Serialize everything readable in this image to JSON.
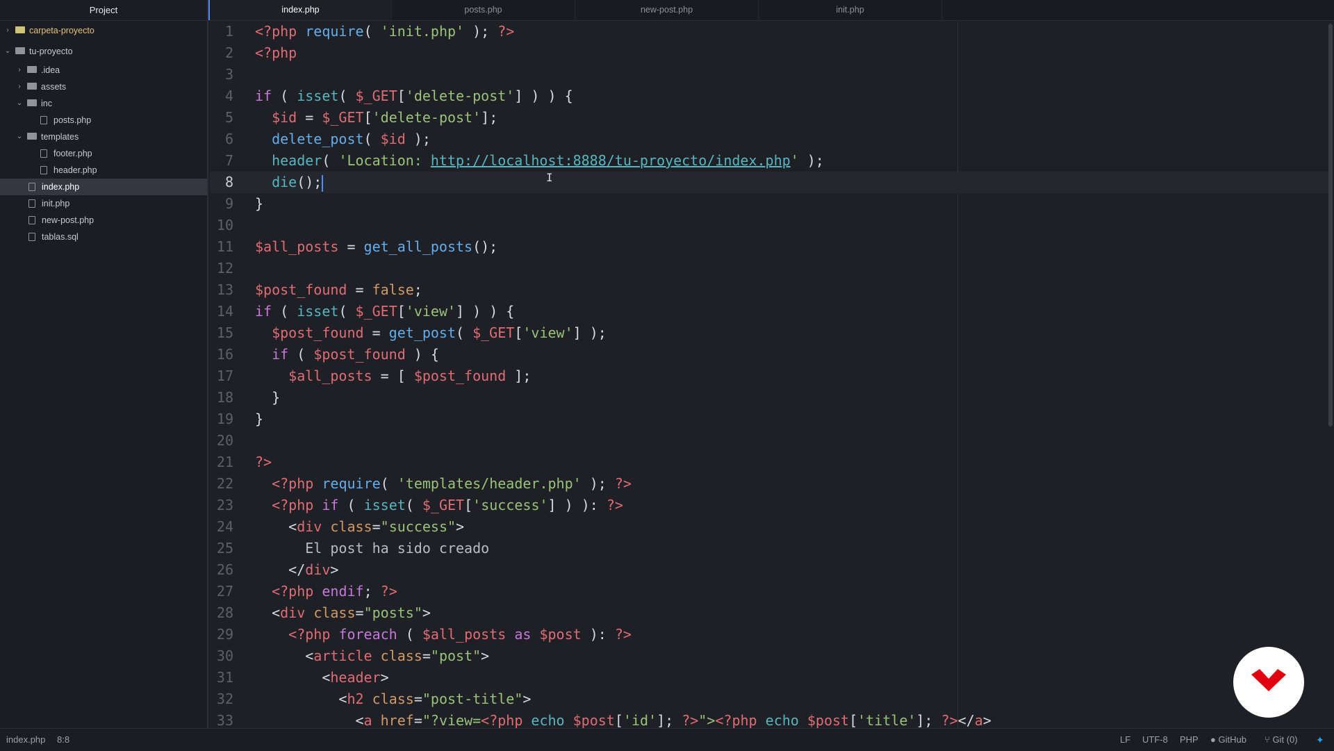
{
  "sidebar": {
    "title": "Project",
    "items": [
      {
        "label": "carpeta-proyecto",
        "type": "folder",
        "expanded": false
      },
      {
        "label": "tu-proyecto",
        "type": "folder",
        "expanded": true
      },
      {
        "label": ".idea",
        "type": "folder",
        "expanded": false
      },
      {
        "label": "assets",
        "type": "folder",
        "expanded": false
      },
      {
        "label": "inc",
        "type": "folder",
        "expanded": true
      },
      {
        "label": "posts.php",
        "type": "file"
      },
      {
        "label": "templates",
        "type": "folder",
        "expanded": true
      },
      {
        "label": "footer.php",
        "type": "file"
      },
      {
        "label": "header.php",
        "type": "file"
      },
      {
        "label": "index.php",
        "type": "file",
        "selected": true
      },
      {
        "label": "init.php",
        "type": "file"
      },
      {
        "label": "new-post.php",
        "type": "file"
      },
      {
        "label": "tablas.sql",
        "type": "file"
      }
    ]
  },
  "tabs": [
    {
      "label": "index.php",
      "active": true
    },
    {
      "label": "posts.php",
      "active": false
    },
    {
      "label": "new-post.php",
      "active": false
    },
    {
      "label": "init.php",
      "active": false
    }
  ],
  "editor": {
    "line_numbers": [
      "1",
      "2",
      "3",
      "4",
      "5",
      "6",
      "7",
      "8",
      "9",
      "10",
      "11",
      "12",
      "13",
      "14",
      "15",
      "16",
      "17",
      "18",
      "19",
      "20",
      "21",
      "22",
      "23",
      "24",
      "25",
      "26",
      "27",
      "28",
      "29",
      "30",
      "31",
      "32",
      "33"
    ],
    "cursor_line": 8,
    "code": {
      "l1": [
        "<?php",
        " ",
        "require",
        "( ",
        "'init.php'",
        " ); ",
        "?>"
      ],
      "l2": [
        "<?php"
      ],
      "l4": [
        "if",
        " ( ",
        "isset",
        "( ",
        "$_GET",
        "[",
        "'delete-post'",
        "] ) ) {"
      ],
      "l5": [
        "  ",
        "$id",
        " = ",
        "$_GET",
        "[",
        "'delete-post'",
        "];"
      ],
      "l6": [
        "  ",
        "delete_post",
        "( ",
        "$id",
        " );"
      ],
      "l7": [
        "  ",
        "header",
        "( ",
        "'Location: ",
        "http://localhost:8888/tu-proyecto/index.php",
        "'",
        " );"
      ],
      "l8": [
        "  ",
        "die",
        "();"
      ],
      "l9": [
        "}"
      ],
      "l11": [
        "$all_posts",
        " = ",
        "get_all_posts",
        "();"
      ],
      "l13": [
        "$post_found",
        " = ",
        "false",
        ";"
      ],
      "l14": [
        "if",
        " ( ",
        "isset",
        "( ",
        "$_GET",
        "[",
        "'view'",
        "] ) ) {"
      ],
      "l15": [
        "  ",
        "$post_found",
        " = ",
        "get_post",
        "( ",
        "$_GET",
        "[",
        "'view'",
        "] );"
      ],
      "l16": [
        "  ",
        "if",
        " ( ",
        "$post_found",
        " ) {"
      ],
      "l17": [
        "    ",
        "$all_posts",
        " = [ ",
        "$post_found",
        " ];"
      ],
      "l18": [
        "  }"
      ],
      "l19": [
        "}"
      ],
      "l21": [
        "?>"
      ],
      "l22": [
        "  ",
        "<?php",
        " ",
        "require",
        "( ",
        "'templates/header.php'",
        " ); ",
        "?>"
      ],
      "l23": [
        "  ",
        "<?php",
        " ",
        "if",
        " ( ",
        "isset",
        "( ",
        "$_GET",
        "[",
        "'success'",
        "] ) ): ",
        "?>"
      ],
      "l24": [
        "    ",
        "<",
        "div",
        " ",
        "class",
        "=",
        "\"success\"",
        ">"
      ],
      "l25": [
        "      ",
        "El post ha sido creado"
      ],
      "l26": [
        "    ",
        "</",
        "div",
        ">"
      ],
      "l27": [
        "  ",
        "<?php",
        " ",
        "endif",
        "; ",
        "?>"
      ],
      "l28": [
        "  ",
        "<",
        "div",
        " ",
        "class",
        "=",
        "\"posts\"",
        ">"
      ],
      "l29": [
        "    ",
        "<?php",
        " ",
        "foreach",
        " ( ",
        "$all_posts",
        " ",
        "as",
        " ",
        "$post",
        " ): ",
        "?>"
      ],
      "l30": [
        "      ",
        "<",
        "article",
        " ",
        "class",
        "=",
        "\"post\"",
        ">"
      ],
      "l31": [
        "        ",
        "<",
        "header",
        ">"
      ],
      "l32": [
        "          ",
        "<",
        "h2",
        " ",
        "class",
        "=",
        "\"post-title\"",
        ">"
      ],
      "l33": [
        "            ",
        "<",
        "a",
        " ",
        "href",
        "=",
        "\"?view=",
        "<?php",
        " ",
        "echo",
        " ",
        "$post",
        "[",
        "'id'",
        "]; ",
        "?>",
        "\">",
        "<?php",
        " ",
        "echo",
        " ",
        "$post",
        "[",
        "'title'",
        "]; ",
        "?>",
        "</",
        "a",
        ">"
      ]
    }
  },
  "statusbar": {
    "file": "index.php",
    "position": "8:8",
    "line_ending": "LF",
    "encoding": "UTF-8",
    "grammar": "PHP",
    "github": "GitHub",
    "git": "Git (0)"
  },
  "colors": {
    "keyword": "#c678dd",
    "function": "#61afef",
    "string": "#98c379",
    "variable": "#e06c75",
    "cursor": "#528bff",
    "logo_red": "#e1000f"
  }
}
